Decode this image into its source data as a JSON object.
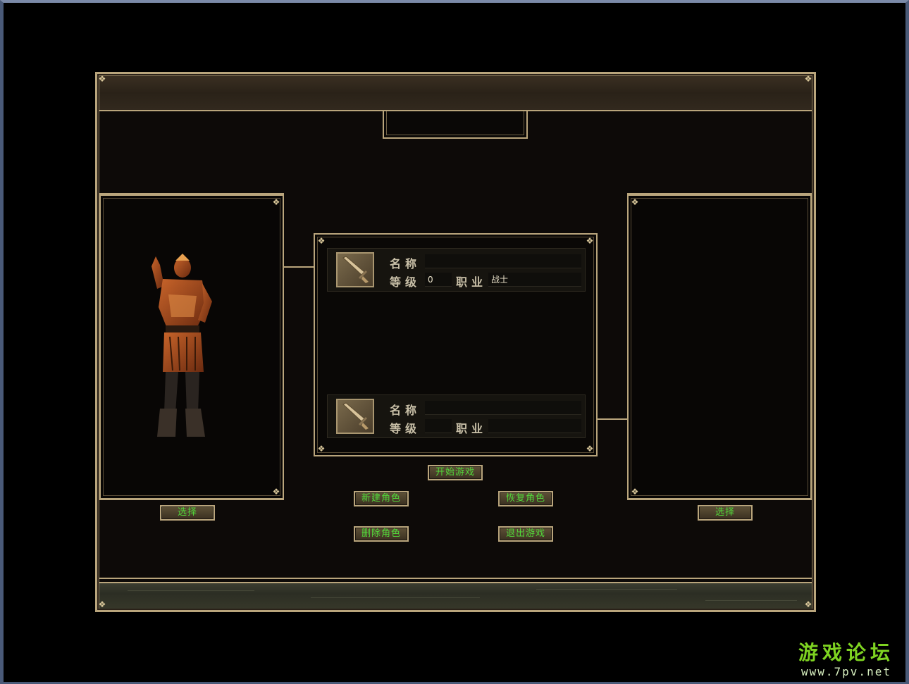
{
  "slots": [
    {
      "name_label": "名称",
      "level_label": "等级",
      "level_value": "0",
      "class_label": "职业",
      "class_value": "战士",
      "name_value": ""
    },
    {
      "name_label": "名称",
      "level_label": "等级",
      "level_value": "",
      "class_label": "职业",
      "class_value": "",
      "name_value": ""
    }
  ],
  "buttons": {
    "select_left": "选择",
    "select_right": "选择",
    "start_game": "开始游戏",
    "new_character": "新建角色",
    "restore_character": "恢复角色",
    "delete_character": "删除角色",
    "exit_game": "退出游戏"
  },
  "watermark": {
    "site_cn": "游戏论坛",
    "site_url": "www.7pv.net"
  },
  "icons": {
    "class_icon": "sword-icon",
    "character": "warrior-armor-figure"
  },
  "colors": {
    "frame_gold": "#b9a57c",
    "button_text_green": "#52d83a",
    "watermark_green": "#7ed321"
  }
}
